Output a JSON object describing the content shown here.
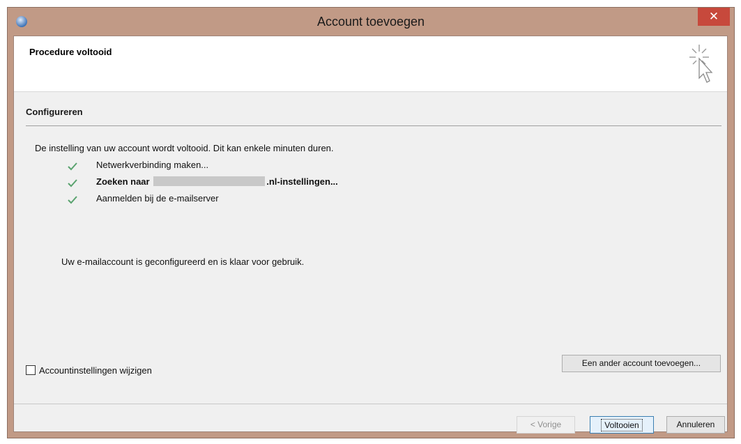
{
  "window": {
    "title": "Account toevoegen",
    "close_glyph": "✕"
  },
  "header": {
    "title": "Procedure voltooid",
    "icon": "wizard-cursor-icon"
  },
  "section": {
    "title": "Configureren",
    "intro": "De instelling van uw account wordt voltooid. Dit kan enkele minuten duren.",
    "steps": [
      {
        "label": "Netwerkverbinding maken...",
        "status": "done"
      },
      {
        "label_prefix": "Zoeken naar",
        "label_suffix": ".nl-instellingen...",
        "status": "done",
        "bold": true
      },
      {
        "label": "Aanmelden bij de e-mailserver",
        "status": "done"
      }
    ],
    "done_message": "Uw e-mailaccount is geconfigureerd en is klaar voor gebruik."
  },
  "options": {
    "change_settings_label": "Accountinstellingen wijzigen",
    "change_settings_checked": false,
    "add_another_label": "Een ander account toevoegen..."
  },
  "footer": {
    "prev_label": "< Vorige",
    "finish_label": "Voltooien",
    "cancel_label": "Annuleren"
  },
  "colors": {
    "titlebar": "#c19a86",
    "close": "#c7493c",
    "check": "#5aa36f"
  }
}
